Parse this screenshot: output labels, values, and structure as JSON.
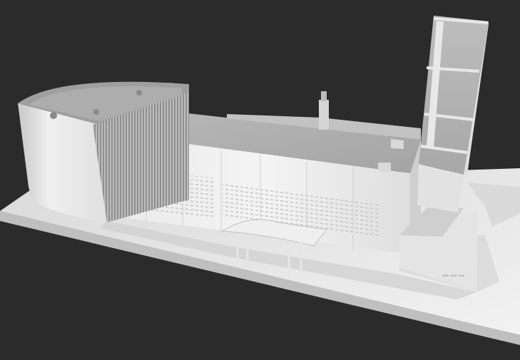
{
  "scene": {
    "subject": "architectural-model-render",
    "background_color": "#2b2b2b",
    "model_color": "#e6e6e6",
    "shadow_color": "#9a9a9a"
  }
}
